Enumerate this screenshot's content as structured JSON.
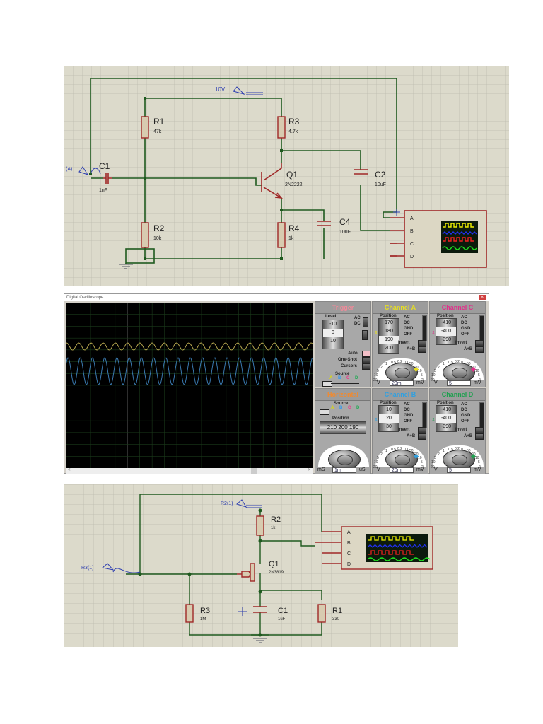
{
  "schematic1": {
    "supply_label": "10V",
    "input_label": "(A)",
    "r1": {
      "ref": "R1",
      "value": "47k"
    },
    "r2": {
      "ref": "R2",
      "value": "10k"
    },
    "r3": {
      "ref": "R3",
      "value": "4.7k"
    },
    "r4": {
      "ref": "R4",
      "value": "1k"
    },
    "c1": {
      "ref": "C1",
      "value": "1nF"
    },
    "c2": {
      "ref": "C2",
      "value": "10uF"
    },
    "c4": {
      "ref": "C4",
      "value": "10uF"
    },
    "q1": {
      "ref": "Q1",
      "value": "2N2222"
    },
    "scope_pins": [
      "A",
      "B",
      "C",
      "D"
    ]
  },
  "oscilloscope": {
    "title": "Digital Oscilloscope",
    "close": "×",
    "scroll_left": "<",
    "scroll_right": ">",
    "traces": [
      {
        "channel": "A",
        "color": "#b8a850"
      },
      {
        "channel": "B",
        "color": "#3a7ab0"
      }
    ],
    "dial_scale": [
      "20",
      "10",
      "5",
      "2",
      "1",
      "0.5",
      "0.2",
      "0.1",
      "50",
      "20",
      "10",
      "5",
      "2"
    ],
    "trigger": {
      "title": "Trigger",
      "color": "#f08a9a",
      "level_label": "Level",
      "drum": [
        "-10",
        "0",
        "10"
      ],
      "coupling": [
        "AC",
        "DC"
      ],
      "buttons": [
        "Auto",
        "One-Shot",
        "Cursors"
      ],
      "source_label": "Source",
      "sources": [
        "A",
        "B",
        "C",
        "D"
      ]
    },
    "horizontal": {
      "title": "Horizontal",
      "color": "#f08a30",
      "source_label": "Source",
      "sources": [
        "A",
        "B",
        "C",
        "D"
      ],
      "position_label": "Position",
      "drum": "210 200 190",
      "value": "1m",
      "unit_left": "mS",
      "unit_right": "uS"
    },
    "channels": [
      {
        "key": "a",
        "title": "Channel A",
        "color": "#e8e020",
        "position_label": "Position",
        "drum": [
          "170",
          "180",
          "190",
          "200"
        ],
        "modes": [
          "AC",
          "DC",
          "GND",
          "OFF"
        ],
        "invert": "Invert",
        "aplusb": "A+B",
        "value": "20m",
        "unit_left": "V",
        "unit_right": "mV"
      },
      {
        "key": "c",
        "title": "Channel C",
        "color": "#e0308a",
        "position_label": "Position",
        "drum": [
          "-410",
          "-400",
          "-390"
        ],
        "modes": [
          "AC",
          "DC",
          "GND",
          "OFF"
        ],
        "invert": "Invert",
        "aplusb": "A+B",
        "value": "5",
        "unit_left": "V",
        "unit_right": "mV"
      },
      {
        "key": "b",
        "title": "Channel B",
        "color": "#30a0e0",
        "position_label": "Position",
        "drum": [
          "10",
          "20",
          "30"
        ],
        "modes": [
          "AC",
          "DC",
          "GND",
          "OFF"
        ],
        "invert": "Invert",
        "aplusb": "A+B",
        "value": "20m",
        "unit_left": "V",
        "unit_right": "mV"
      },
      {
        "key": "d",
        "title": "Channel D",
        "color": "#20a050",
        "position_label": "Position",
        "drum": [
          "-410",
          "-400",
          "-390"
        ],
        "modes": [
          "AC",
          "DC",
          "GND",
          "OFF"
        ],
        "invert": "Invert",
        "aplusb": "A+B",
        "value": "5",
        "unit_left": "V",
        "unit_right": "mV"
      }
    ]
  },
  "schematic2": {
    "supply_label": "R2(1)",
    "input_label": "R3(1)",
    "r1": {
      "ref": "R1",
      "value": "330"
    },
    "r2": {
      "ref": "R2",
      "value": "1k"
    },
    "r3": {
      "ref": "R3",
      "value": "1M"
    },
    "c1": {
      "ref": "C1",
      "value": "1uF"
    },
    "q1": {
      "ref": "Q1",
      "value": "2N3819"
    },
    "scope_pins": [
      "A",
      "B",
      "C",
      "D"
    ]
  }
}
